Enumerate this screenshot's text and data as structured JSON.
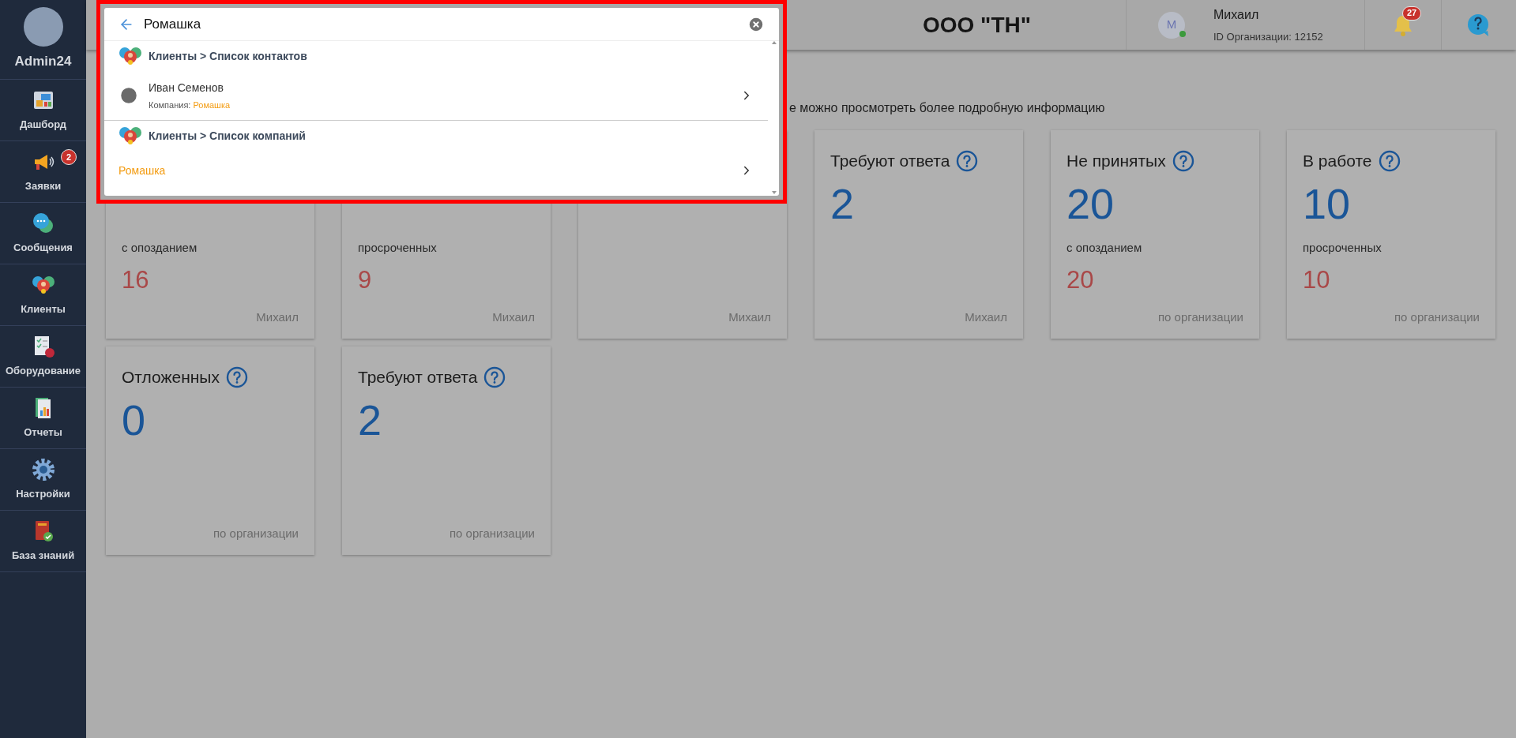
{
  "sidebar": {
    "user": "Admin24",
    "items": [
      {
        "label": "Дашборд"
      },
      {
        "label": "Заявки",
        "badge": "2"
      },
      {
        "label": "Сообщения"
      },
      {
        "label": "Клиенты"
      },
      {
        "label": "Оборудование"
      },
      {
        "label": "Отчеты"
      },
      {
        "label": "Настройки"
      },
      {
        "label": "База знаний"
      }
    ]
  },
  "header": {
    "company": "ООО \"ТН\"",
    "avatar_letter": "M",
    "online": true,
    "user_name": "Михаил",
    "org_id": "ID Организации: 12152",
    "notifications": "27"
  },
  "description": "е можно просмотреть более подробную информацию",
  "cards": [
    {
      "sub_label": "с опозданием",
      "sub_value": "16",
      "footer": "Михаил"
    },
    {
      "sub_label": "просроченных",
      "sub_value": "9",
      "footer": "Михаил"
    },
    {
      "footer": "Михаил"
    },
    {
      "title": "Требуют ответа",
      "value": "2",
      "footer": "Михаил"
    },
    {
      "title": "Не принятых",
      "value": "20",
      "sub_label": "с опозданием",
      "sub_value": "20",
      "footer": "по организации"
    },
    {
      "title": "В работе",
      "value": "10",
      "sub_label": "просроченных",
      "sub_value": "10",
      "footer": "по организации"
    },
    {
      "title": "Отложенных",
      "value": "0",
      "footer": "по организации"
    },
    {
      "title": "Требуют ответа",
      "value": "2",
      "footer": "по организации"
    }
  ],
  "search": {
    "value": "Ромашка",
    "sections": [
      {
        "title": "Клиенты > Список контактов",
        "results": [
          {
            "kind": "contact",
            "name": "Иван Семенов",
            "company_label": "Компания:",
            "company": "Ромашка"
          }
        ]
      },
      {
        "title": "Клиенты > Список компаний",
        "results": [
          {
            "kind": "company",
            "name": "Ромашка"
          }
        ]
      }
    ]
  }
}
